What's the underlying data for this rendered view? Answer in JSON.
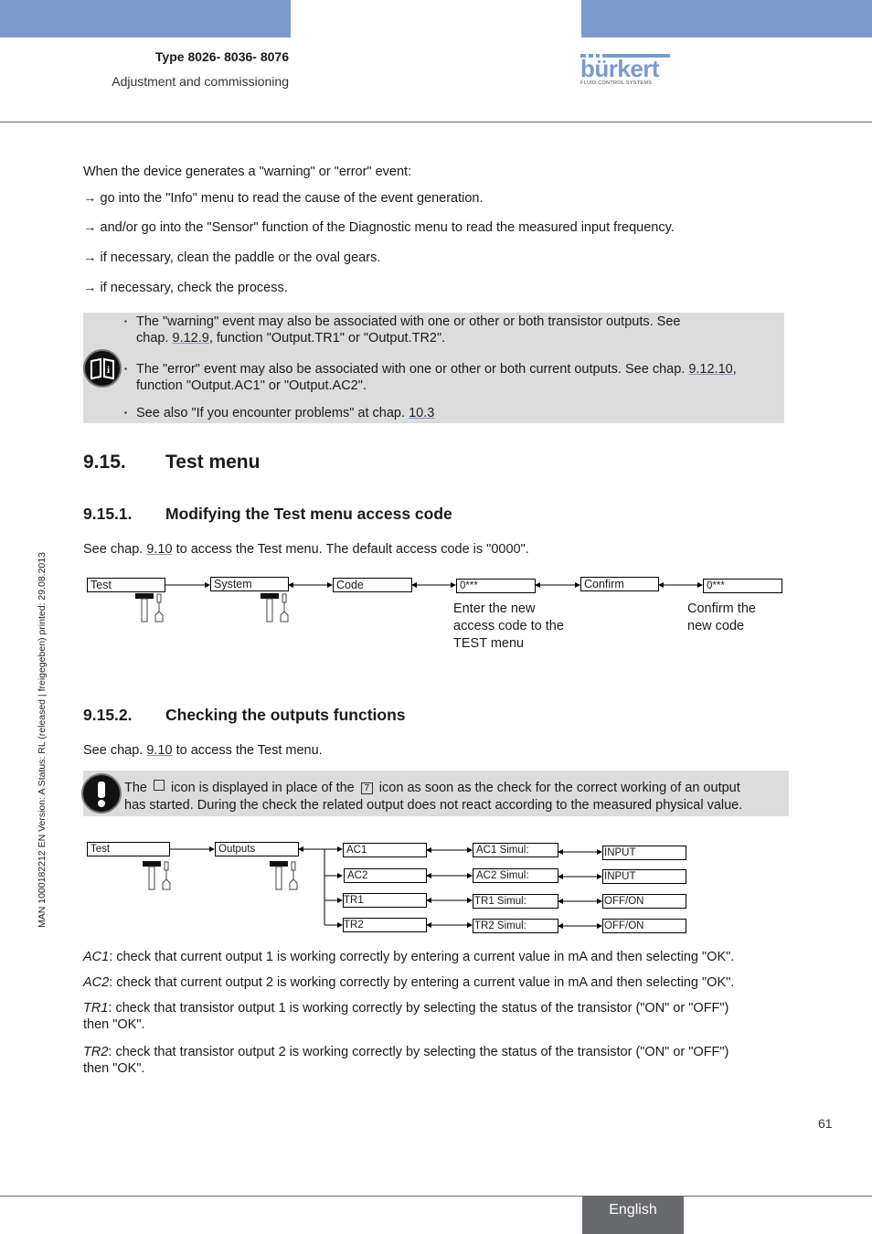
{
  "header": {
    "type": "Type 8026- 8036- 8076",
    "subtitle": "Adjustment and commissioning",
    "logo": {
      "word": "bürkert",
      "tagline": "FLUID CONTROL SYSTEMS"
    },
    "brand_color": "#7b9acc"
  },
  "sidebar_text": "MAN  1000182212  EN  Version: A  Status: RL (released | freigegeben)  printed: 29.08.2013",
  "intro": {
    "lead": "When the device generates a \"warning\" or \"error\" event:",
    "steps": [
      "→ go into the \"Info\" menu to read the cause of the event generation.",
      "→ and/or go into the \"Sensor\" function of the Diagnostic menu to read the measured input frequency.",
      "→ if necessary, clean the paddle or the oval gears.",
      "→ if necessary, check the process."
    ]
  },
  "info_note": {
    "icon": "book-info-icon",
    "bullet": "▪",
    "items": [
      {
        "l1_pre": "The \"warning\" event may also be associated with one or other or both transistor outputs. See",
        "l2_pre": "chap. ",
        "link": "9.12.9",
        "l2_post": ", function \"Output.TR1\" or \"Output.TR2\"."
      },
      {
        "l1_pre": "The \"error\" event may also be associated with one or other or both current outputs. See chap. ",
        "link": "9.12.10",
        "l1_post": ",",
        "l2_pre": "function \"Output.AC1\" or \"Output.AC2\"."
      },
      {
        "l1_pre": "See also \"If you encounter problems\" at chap. ",
        "link": "10.3"
      }
    ]
  },
  "section": {
    "num": "9.15.",
    "title": "Test menu"
  },
  "sub1": {
    "num": "9.15.1.",
    "title": "Modifying the Test menu access code",
    "text_pre": "See chap. ",
    "link": "9.10",
    "text_post": " to access the Test menu. The default access code is \"0000\".",
    "flow": [
      "Test",
      "System",
      "Code",
      "0***",
      "Confirm",
      "0***"
    ],
    "note_enter": [
      "Enter the new",
      "access code to the",
      "TEST menu"
    ],
    "note_confirm": [
      "Confirm the",
      "new code"
    ]
  },
  "sub2": {
    "num": "9.15.2.",
    "title": "Checking the outputs functions",
    "text_pre": "See chap. ",
    "link": "9.10",
    "text_post": " to access the Test menu.",
    "warning": {
      "icon": "exclamation-icon",
      "l1_a": "The ",
      "l1_b": " icon is displayed in place of the ",
      "l1_c": " icon as soon as the check for the correct working of an output",
      "l2": "has started. During the check the related output does not react according to the measured physical value."
    },
    "flow": {
      "root": "Test",
      "menu": "Outputs",
      "outputs": [
        "AC1",
        "AC2",
        "TR1",
        "TR2"
      ],
      "simul": [
        "AC1 Simul:",
        "AC2 Simul:",
        "TR1 Simul:",
        "TR2 Simul:"
      ],
      "values": [
        "INPUT",
        "INPUT",
        "OFF/ON",
        "OFF/ON"
      ]
    },
    "descriptions": [
      {
        "term": "AC1",
        "l1": ": check that current output 1 is working correctly by entering a current value in mA and then selecting \"OK\"."
      },
      {
        "term": "AC2",
        "l1": ": check that current output 2 is working correctly by entering a current value in mA and then selecting \"OK\"."
      },
      {
        "term": "TR1",
        "l1": ": check that transistor output 1 is working correctly by selecting the status of the transistor (\"ON\" or \"OFF\")",
        "l2": "then \"OK\"."
      },
      {
        "term": "TR2",
        "l1": ": check that transistor output 2 is working correctly by selecting the status of the transistor (\"ON\" or \"OFF\")",
        "l2": "then \"OK\"."
      }
    ]
  },
  "footer": {
    "page": "61",
    "language": "English"
  }
}
